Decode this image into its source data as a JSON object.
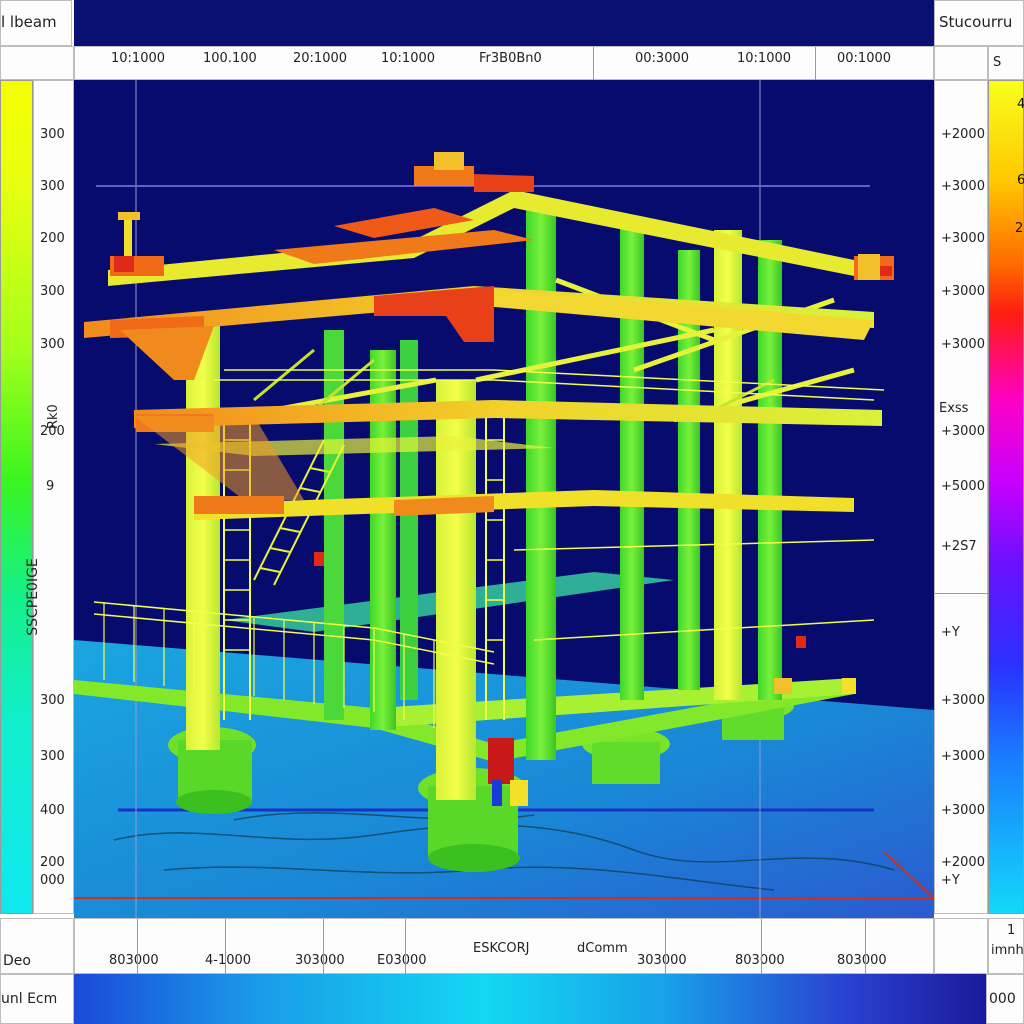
{
  "window": {
    "title_left": "l lbeam",
    "title_right": "Stucourru",
    "right_header_partial": "S"
  },
  "top_axis": {
    "ticks": [
      "10:1000",
      "100.100",
      "20:1000",
      "10:1000",
      "Fr3B0Bn0",
      "00:3000",
      "10:1000",
      "00:1000"
    ]
  },
  "left_scale": {
    "ticks": [
      "300",
      "300",
      "200",
      "300",
      "300",
      "Rk0",
      "200",
      "9",
      "SSCPE0IGE",
      "300",
      "300",
      "400",
      "200",
      "000"
    ]
  },
  "right_scale": {
    "ticks": [
      "+2000",
      "+3000",
      "+3000",
      "+3000",
      "+3000",
      "Exss",
      "+3000",
      "+5000",
      "+2S7",
      "+Y",
      "+3000",
      "+3000",
      "+3000",
      "+2000",
      "+Y"
    ]
  },
  "right_bar_marks": [
    "4",
    "6",
    "2"
  ],
  "bottom_axis": {
    "left_label": "Deo",
    "ticks": [
      "803000",
      "4-1000",
      "303000",
      "E03000",
      "ESKCORJ",
      "dComm",
      "303000",
      "803000",
      "803000"
    ],
    "right_label_line1": "1",
    "right_label_line2": "imnh"
  },
  "status": {
    "left_label": "unl Ecm",
    "right_value": "000"
  },
  "colors": {
    "viewport_bg": "#070b6e",
    "water": "#1a9fd8",
    "structure_yellow": "#e8f23a",
    "structure_green": "#5ee82c",
    "structure_orange": "#f07a1a",
    "structure_red": "#e02a18"
  },
  "icons": {
    "crane_left": "crane-icon",
    "crane_right": "crane-icon"
  }
}
